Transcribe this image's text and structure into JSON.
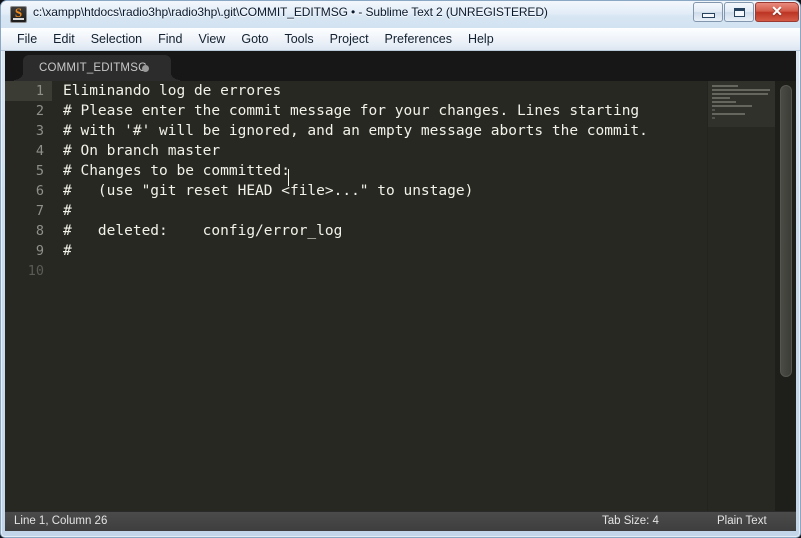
{
  "window": {
    "title": "c:\\xampp\\htdocs\\radio3hp\\radio3hp\\.git\\COMMIT_EDITMSG • - Sublime Text 2 (UNREGISTERED)",
    "app_icon_letter": "S",
    "controls": {
      "minimize_label": "Minimize",
      "maximize_label": "Maximize",
      "close_label": "✕"
    },
    "colors": {
      "frame": "#c3d5e8",
      "titlebar": "#e3edf7",
      "close_button": "#bc3424"
    }
  },
  "menubar": {
    "items": [
      {
        "label": "File"
      },
      {
        "label": "Edit"
      },
      {
        "label": "Selection"
      },
      {
        "label": "Find"
      },
      {
        "label": "View"
      },
      {
        "label": "Goto"
      },
      {
        "label": "Tools"
      },
      {
        "label": "Project"
      },
      {
        "label": "Preferences"
      },
      {
        "label": "Help"
      }
    ]
  },
  "tabs": [
    {
      "label": "COMMIT_EDITMSG",
      "dirty": true
    }
  ],
  "editor": {
    "colors": {
      "background": "#272822",
      "foreground": "#f2f2e9",
      "gutter_text": "#8f908a",
      "active_line_gutter": "#3b3c34",
      "caret": "#f8f8f0"
    },
    "lines": [
      {
        "number": "1",
        "text": "Eliminando log de errores",
        "active": true
      },
      {
        "number": "2",
        "text": "# Please enter the commit message for your changes. Lines starting",
        "active": false
      },
      {
        "number": "3",
        "text": "# with '#' will be ignored, and an empty message aborts the commit.",
        "active": false
      },
      {
        "number": "4",
        "text": "# On branch master",
        "active": false
      },
      {
        "number": "5",
        "text": "# Changes to be committed:",
        "active": false
      },
      {
        "number": "6",
        "text": "#   (use \"git reset HEAD <file>...\" to unstage)",
        "active": false
      },
      {
        "number": "7",
        "text": "#",
        "active": false
      },
      {
        "number": "8",
        "text": "#   deleted:    config/error_log",
        "active": false
      },
      {
        "number": "9",
        "text": "#",
        "active": false
      },
      {
        "number": "10",
        "text": "",
        "active": false,
        "trailing": true
      }
    ]
  },
  "statusbar": {
    "cursor_position": "Line 1, Column 26",
    "tab_size": "Tab Size: 4",
    "syntax": "Plain Text"
  }
}
